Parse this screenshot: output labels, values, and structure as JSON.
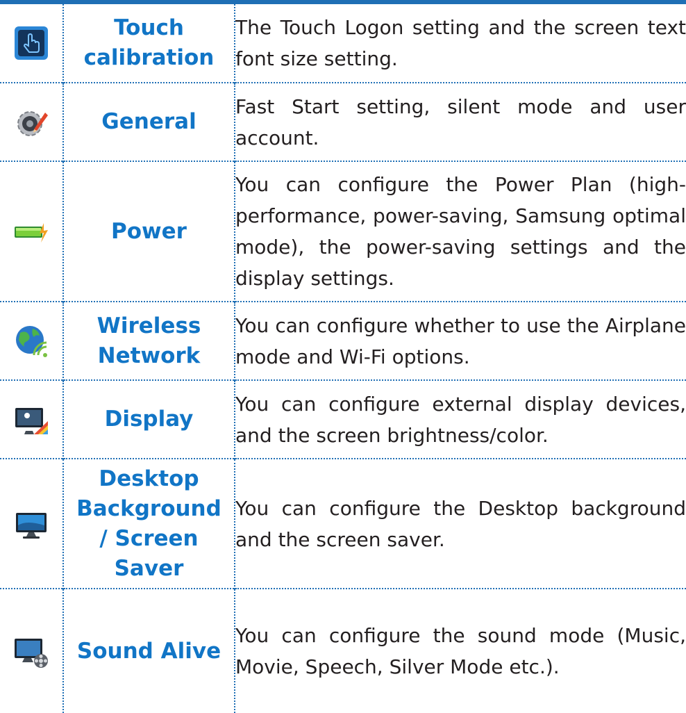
{
  "rows": [
    {
      "icon": "touch-calibration-icon",
      "name": "Touch\ncalibration",
      "description": "The Touch Logon setting and the screen text font size setting."
    },
    {
      "icon": "gear-pen-icon",
      "name": "General",
      "description": "Fast Start setting, silent mode and user account."
    },
    {
      "icon": "battery-charging-icon",
      "name": "Power",
      "description": "You can configure the Power Plan (high-performance, power-saving, Samsung optimal mode), the power-saving settings and the display settings."
    },
    {
      "icon": "globe-wifi-icon",
      "name": "Wireless\nNetwork",
      "description": "You can configure whether to use the Airplane mode and Wi-Fi options."
    },
    {
      "icon": "monitor-brightness-icon",
      "name": "Display",
      "description": "You can configure external display devices, and the screen brightness/color."
    },
    {
      "icon": "monitor-desktop-icon",
      "name": "Desktop\nBackground\n/ Screen\nSaver",
      "description": "You can configure the Desktop background and the screen saver."
    },
    {
      "icon": "monitor-film-reel-icon",
      "name": "Sound Alive",
      "description": "You can configure the sound mode (Music, Movie, Speech, Silver Mode etc.)."
    }
  ],
  "colors": {
    "accent": "#1f6fb5",
    "heading": "#1175c6",
    "body_text": "#231f20"
  }
}
